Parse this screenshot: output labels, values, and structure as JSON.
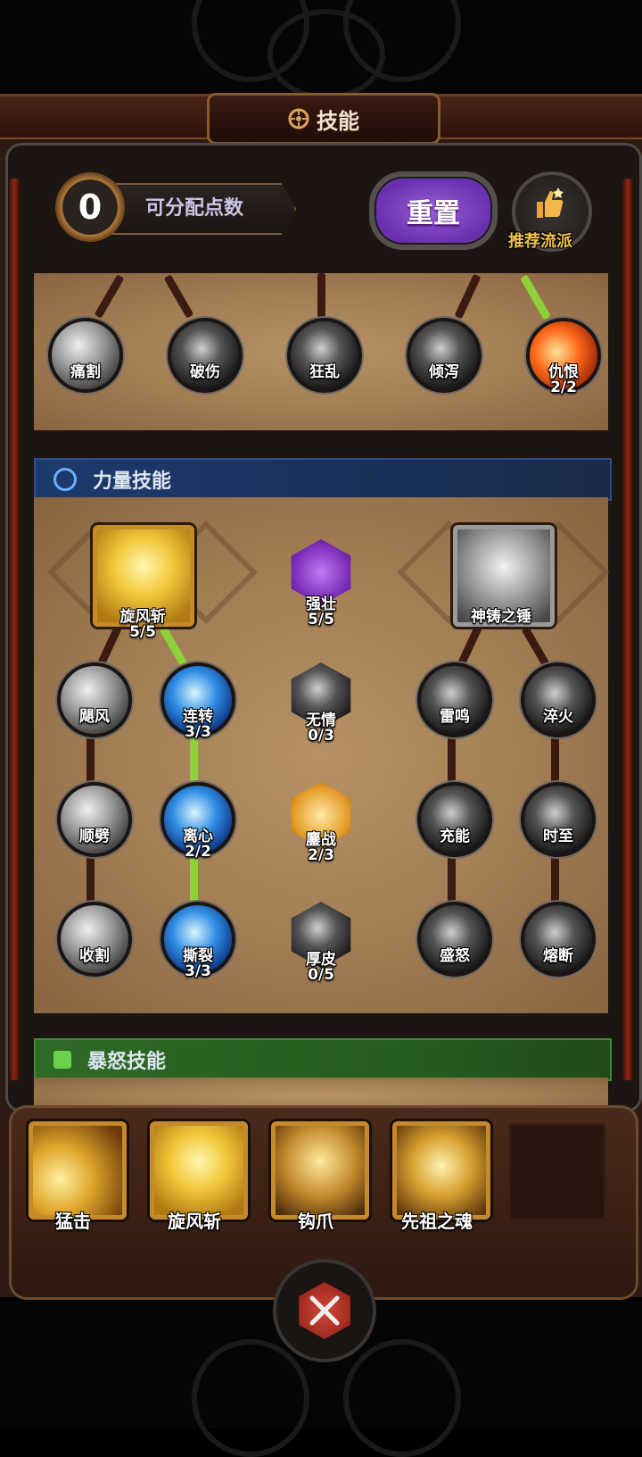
{
  "header": {
    "title": "技能"
  },
  "points": {
    "value": "0",
    "label": "可分配点数"
  },
  "buttons": {
    "reset": "重置",
    "recommend": "推荐流派"
  },
  "top_row": [
    {
      "name": "痛割",
      "level": ""
    },
    {
      "name": "破伤",
      "level": ""
    },
    {
      "name": "狂乱",
      "level": ""
    },
    {
      "name": "倾泻",
      "level": ""
    },
    {
      "name": "仇恨",
      "level": "2/2"
    }
  ],
  "strength": {
    "title": "力量技能",
    "main_left": {
      "name": "旋风斩",
      "level": "5/5"
    },
    "main_mid": {
      "name": "强壮",
      "level": "5/5"
    },
    "main_right": {
      "name": "神铸之锤"
    },
    "col1": [
      {
        "name": "飓风"
      },
      {
        "name": "顺劈"
      },
      {
        "name": "收割"
      }
    ],
    "col2": [
      {
        "name": "连转",
        "level": "3/3"
      },
      {
        "name": "离心",
        "level": "2/2"
      },
      {
        "name": "撕裂",
        "level": "3/3"
      }
    ],
    "col3": [
      {
        "name": "无情",
        "level": "0/3"
      },
      {
        "name": "鏖战",
        "level": "2/3"
      },
      {
        "name": "厚皮",
        "level": "0/5"
      }
    ],
    "col4": [
      {
        "name": "雷鸣"
      },
      {
        "name": "充能"
      },
      {
        "name": "盛怒"
      }
    ],
    "col5": [
      {
        "name": "淬火"
      },
      {
        "name": "时至"
      },
      {
        "name": "熔断"
      }
    ]
  },
  "rage": {
    "title": "暴怒技能"
  },
  "equipped": [
    {
      "name": "猛击"
    },
    {
      "name": "旋风斩"
    },
    {
      "name": "钩爪"
    },
    {
      "name": "先祖之魂"
    }
  ],
  "colors": {
    "accent_green": "#8ed13a",
    "reset_purple": "#7a3ac4",
    "gold_border": "#c48a2c"
  }
}
